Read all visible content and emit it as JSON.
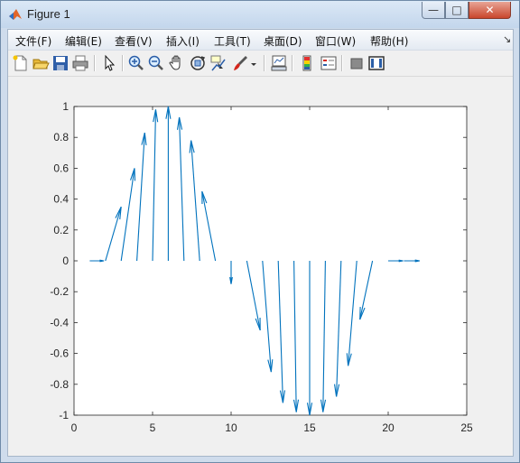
{
  "window": {
    "title": "Figure 1",
    "minimize": "—",
    "maximize": "□",
    "close": "✕"
  },
  "menu": [
    {
      "label": "文件(F)"
    },
    {
      "label": "编辑(E)"
    },
    {
      "label": "查看(V)"
    },
    {
      "label": "插入(I)"
    },
    {
      "label": "工具(T)"
    },
    {
      "label": "桌面(D)"
    },
    {
      "label": "窗口(W)"
    },
    {
      "label": "帮助(H)"
    }
  ],
  "toolbar": [
    "new-figure-icon",
    "open-file-icon",
    "save-icon",
    "print-icon",
    "pointer-icon",
    "zoom-in-icon",
    "zoom-out-icon",
    "pan-icon",
    "rotate-3d-icon",
    "data-cursor-icon",
    "brush-icon",
    "brush-dropdown-icon",
    "link-plot-icon",
    "colorbar-icon",
    "legend-icon",
    "hide-plot-tools-icon",
    "show-plot-tools-icon"
  ],
  "colors": {
    "quiver": "#0072BD",
    "axes_bg": "#ffffff",
    "figure_bg": "#f0f0f0"
  },
  "chart_data": {
    "type": "quiver",
    "title": "",
    "xlabel": "",
    "ylabel": "",
    "xlim": [
      0,
      25
    ],
    "ylim": [
      -1,
      1
    ],
    "xticks": [
      "0",
      "5",
      "10",
      "15",
      "20",
      "25"
    ],
    "yticks": [
      "1",
      "0.8",
      "0.6",
      "0.4",
      "0.2",
      "0",
      "-0.2",
      "-0.4",
      "-0.6",
      "-0.8",
      "-1"
    ],
    "x": [
      1,
      2,
      3,
      4,
      5,
      6,
      7,
      8,
      9,
      10,
      11,
      12,
      13,
      14,
      15,
      16,
      17,
      18,
      19,
      20,
      21
    ],
    "y": [
      0,
      0,
      0,
      0,
      0,
      0,
      0,
      0,
      0,
      0,
      0,
      0,
      0,
      0,
      0,
      0,
      0,
      0,
      0,
      0,
      0
    ],
    "u": [
      0.9,
      1.0,
      0.85,
      0.5,
      0.2,
      0.0,
      -0.3,
      -0.55,
      -0.85,
      0.0,
      0.85,
      0.55,
      0.3,
      0.15,
      0.0,
      -0.15,
      -0.3,
      -0.55,
      -0.8,
      0.95,
      1.0
    ],
    "v": [
      0,
      0.35,
      0.6,
      0.83,
      0.98,
      1.0,
      0.93,
      0.78,
      0.45,
      -0.15,
      -0.45,
      -0.72,
      -0.92,
      -0.98,
      -1.0,
      -0.98,
      -0.88,
      -0.68,
      -0.38,
      0,
      0
    ]
  }
}
